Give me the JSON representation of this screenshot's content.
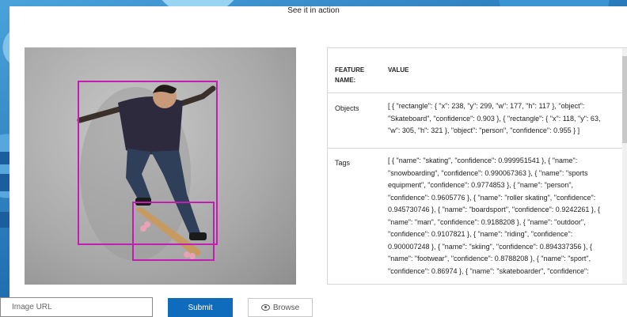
{
  "header": {
    "title": "See it in action"
  },
  "image_panel": {
    "detections": [
      {
        "object": "Skateboard",
        "color": "#c21fb2"
      },
      {
        "object": "person",
        "color": "#c21fb2"
      }
    ]
  },
  "results": {
    "columns": {
      "feature": "FEATURE NAME:",
      "value": "VALUE"
    },
    "rows": [
      {
        "feature": "Objects",
        "value": "[ { \"rectangle\": { \"x\": 238, \"y\": 299, \"w\": 177, \"h\": 117 }, \"object\": \"Skateboard\", \"confidence\": 0.903 }, { \"rectangle\": { \"x\": 118, \"y\": 63, \"w\": 305, \"h\": 321 }, \"object\": \"person\", \"confidence\": 0.955 } ]"
      },
      {
        "feature": "Tags",
        "value": "[ { \"name\": \"skating\", \"confidence\": 0.999951541 }, { \"name\": \"snowboarding\", \"confidence\": 0.990067363 }, { \"name\": \"sports equipment\", \"confidence\": 0.9774853 }, { \"name\": \"person\", \"confidence\": 0.9605776 }, { \"name\": \"roller skating\", \"confidence\": 0.945730746 }, { \"name\": \"boardsport\", \"confidence\": 0.9242261 }, { \"name\": \"man\", \"confidence\": 0.9188208 }, { \"name\": \"outdoor\", \"confidence\": 0.9107821 }, { \"name\": \"riding\", \"confidence\": 0.900007248 }, { \"name\": \"skiing\", \"confidence\": 0.894337356 }, { \"name\": \"footwear\", \"confidence\": 0.8788208 }, { \"name\": \"sport\", \"confidence\": 0.86974 }, { \"name\": \"skateboarder\", \"confidence\":"
      }
    ]
  },
  "controls": {
    "url_placeholder": "Image URL",
    "submit_label": "Submit",
    "browse_label": "Browse",
    "browse_icon": "eye-icon",
    "accent_color": "#0f6cbd"
  }
}
